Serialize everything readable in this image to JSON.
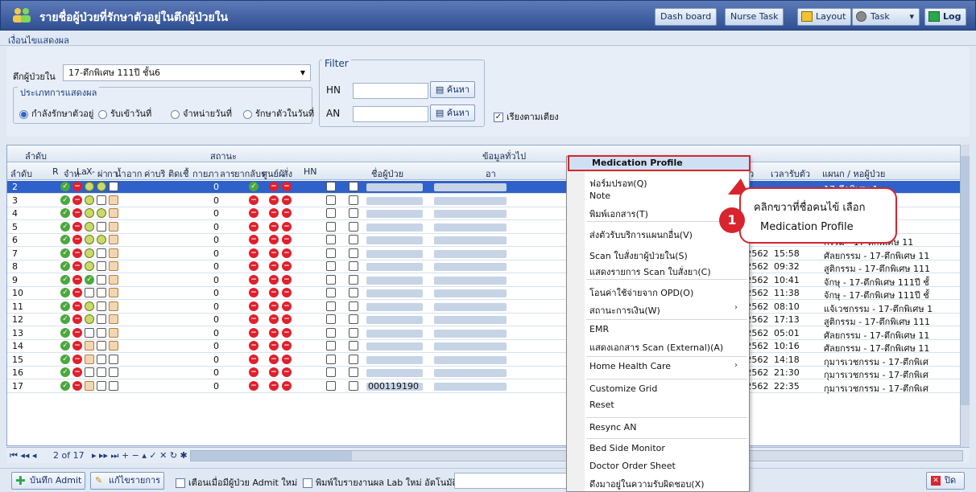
{
  "window": {
    "title": "รายชื่อผู้ป่วยที่รักษาตัวอยู่ในตึกผู้ป่วยใน",
    "buttons": {
      "dashboard": "Dash board",
      "nurse_task": "Nurse Task",
      "layout": "Layout",
      "task": "Task",
      "log": "Log"
    }
  },
  "menu": {
    "conditions": "เงื่อนไขแสดงผล"
  },
  "filters": {
    "ward_label": "ตึกผู้ป่วยใน",
    "ward_value": "17-ตึกพิเศษ 111ปี ชั้น6",
    "display_type_title": "ประเภทการแสดงผล",
    "radios": [
      "กำลังรักษาตัวอยู่",
      "รับเข้าวันที่",
      "จำหน่ายวันที่",
      "รักษาตัวในวันที่"
    ],
    "filter_title": "Filter",
    "hn_label": "HN",
    "an_label": "AN",
    "search_label": "ค้นหา",
    "sort_by_bed": "เรียงตามเตียง"
  },
  "grid": {
    "group_headers": {
      "order": "ลำดับ",
      "status": "สถานะ",
      "general": "ข้อมูลทั่วไป"
    },
    "columns": [
      "ลำดับ",
      "R",
      "จำห",
      "La",
      "X-",
      "ผ่า",
      "กา",
      "น้ำ",
      "อาก",
      "ค่าบริ",
      "ติดเชื้",
      "กายภา",
      "ลาร",
      "ยากลับร",
      "ศูนย์ผั",
      "สั่ง",
      "HN",
      "ชื่อผู้ป่วย",
      "อา",
      "วันที่รับตัว",
      "เวลารับตัว",
      "แผนก / หอผู้ป่วย"
    ],
    "rows": [
      {
        "n": "2",
        "icons": [
          "ok",
          "no",
          "yc",
          "yc",
          "bx"
        ],
        "v": "0",
        "s": [
          "ok",
          "no",
          "no"
        ],
        "hn": "",
        "date": "",
        "time": "",
        "dept": "17-ตึกพิเศษ 1"
      },
      {
        "n": "3",
        "icons": [
          "ok",
          "no",
          "yc",
          "bx",
          "doc"
        ],
        "v": "0",
        "s": [
          "no",
          "no",
          "no"
        ],
        "hn": "",
        "date": "",
        "time": "",
        "dept": "ษม 111ปี ชั้"
      },
      {
        "n": "4",
        "icons": [
          "ok",
          "no",
          "yc",
          "yc",
          "doc"
        ],
        "v": "0",
        "s": [
          "no",
          "no",
          "no"
        ],
        "hn": "",
        "date": "",
        "time": "",
        "dept": "7-ตึกพิเศษ 11"
      },
      {
        "n": "5",
        "icons": [
          "ok",
          "no",
          "yc",
          "bx",
          "doc"
        ],
        "v": "0",
        "s": [
          "no",
          "no",
          "no"
        ],
        "hn": "",
        "date": "",
        "time": "",
        "dept": "7-ตึกพิเศษ 111"
      },
      {
        "n": "6",
        "icons": [
          "ok",
          "no",
          "yc",
          "yc",
          "doc"
        ],
        "v": "0",
        "s": [
          "no",
          "no",
          "no"
        ],
        "hn": "",
        "date": "",
        "time": "",
        "dept": "กรรม - 17-ตึกพิเศษ 11"
      },
      {
        "n": "7",
        "icons": [
          "ok",
          "no",
          "yc",
          "bx",
          "doc"
        ],
        "v": "0",
        "s": [
          "no",
          "no",
          "no"
        ],
        "hn": "",
        "date": "24/10/2562",
        "time": "15:58",
        "dept": "ศัลยกรรม - 17-ตึกพิเศษ 11"
      },
      {
        "n": "8",
        "icons": [
          "ok",
          "no",
          "yc",
          "bx",
          "doc"
        ],
        "v": "0",
        "s": [
          "no",
          "no",
          "no"
        ],
        "hn": "",
        "date": "24/10/2562",
        "time": "09:32",
        "dept": "สูติกรรม - 17-ตึกพิเศษ 111"
      },
      {
        "n": "9",
        "icons": [
          "ok",
          "no",
          "ok",
          "bx",
          "doc"
        ],
        "v": "0",
        "s": [
          "no",
          "no",
          "no"
        ],
        "hn": "",
        "date": "28/10/2562",
        "time": "10:41",
        "dept": "จักษุ - 17-ตึกพิเศษ 111ปี ชั้"
      },
      {
        "n": "10",
        "icons": [
          "ok",
          "no",
          "bx",
          "bx",
          "doc"
        ],
        "v": "0",
        "s": [
          "no",
          "no",
          "no"
        ],
        "hn": "",
        "date": "28/10/2562",
        "time": "11:38",
        "dept": "จักษุ - 17-ตึกพิเศษ 111ปี ชั้"
      },
      {
        "n": "11",
        "icons": [
          "ok",
          "no",
          "yc",
          "bx",
          "doc"
        ],
        "v": "0",
        "s": [
          "no",
          "no",
          "no"
        ],
        "hn": "",
        "date": "27/10/2562",
        "time": "08:10",
        "dept": "แจ้เวชกรรม - 17-ตึกพิเศษ 1"
      },
      {
        "n": "12",
        "icons": [
          "ok",
          "no",
          "yc",
          "bx",
          "doc"
        ],
        "v": "0",
        "s": [
          "no",
          "no",
          "no"
        ],
        "hn": "",
        "date": "26/10/2562",
        "time": "17:13",
        "dept": "สูติกรรม - 17-ตึกพิเศษ 111"
      },
      {
        "n": "13",
        "icons": [
          "ok",
          "no",
          "bx",
          "bx",
          "doc"
        ],
        "v": "0",
        "s": [
          "no",
          "no",
          "no"
        ],
        "hn": "",
        "date": "26/10/2562",
        "time": "05:01",
        "dept": "ศัลยกรรม - 17-ตึกพิเศษ 11"
      },
      {
        "n": "14",
        "icons": [
          "ok",
          "no",
          "doc",
          "bx",
          "doc"
        ],
        "v": "0",
        "s": [
          "no",
          "no",
          "no"
        ],
        "hn": "",
        "date": "27/10/2562",
        "time": "10:16",
        "dept": "ศัลยกรรม - 17-ตึกพิเศษ 11"
      },
      {
        "n": "15",
        "icons": [
          "ok",
          "no",
          "doc",
          "bx",
          "bx"
        ],
        "v": "0",
        "s": [
          "no",
          "no",
          "no"
        ],
        "hn": "",
        "date": "28/10/2562",
        "time": "14:18",
        "dept": "กุมารเวชกรรม - 17-ตึกพิเศ"
      },
      {
        "n": "16",
        "icons": [
          "ok",
          "no",
          "bx",
          "bx",
          "bx"
        ],
        "v": "0",
        "s": [
          "no",
          "no",
          "no"
        ],
        "hn": "",
        "date": "28/10/2562",
        "time": "21:30",
        "dept": "กุมารเวชกรรม - 17-ตึกพิเศ"
      },
      {
        "n": "17",
        "icons": [
          "ok",
          "no",
          "doc",
          "bx",
          "bx"
        ],
        "v": "0",
        "s": [
          "no",
          "no",
          "no"
        ],
        "hn": "000119190",
        "date": "26/10/2562",
        "time": "22:35",
        "dept": "กุมารเวชกรรม - 17-ตึกพิเศ"
      }
    ]
  },
  "pager": {
    "text": "2 of 17"
  },
  "bottom": {
    "save_admit": "บันทึก Admit",
    "edit_list": "แก้ไขรายการ",
    "notify_admit": "เตือนเมื่อมีผู้ป่วย Admit ใหม่",
    "print_lab": "พิมพ์ใบรายงานผล Lab ใหม่ อัตโนมัติ",
    "close": "ปิด"
  },
  "context_menu": [
    "Medication Profile",
    "ฟอร์มปรอท(Q)",
    "Note",
    "พิมพ์เอกสาร(T)",
    "ส่งตัวรับบริการแผนกอื่น(V)",
    "Scan ใบสั่งยาผู้ป่วยใน(S)",
    "แสดงรายการ Scan ใบสั่งยา(C)",
    "โอนค่าใช้จ่ายจาก OPD(O)",
    "สถานะการเงิน(W)",
    "EMR",
    "แสดงเอกสาร Scan (External)(A)",
    "Home Health Care",
    "Customize Grid",
    "Reset",
    "Resync AN",
    "Bed Side Monitor",
    "Doctor Order Sheet",
    "ดึงมาอยู่ในความรับผิดชอบ(X)"
  ],
  "callout": {
    "step": "1",
    "line1": "คลิกขวาที่ชื่อคนไข้ เลือก",
    "line2": "Medication Profile"
  }
}
